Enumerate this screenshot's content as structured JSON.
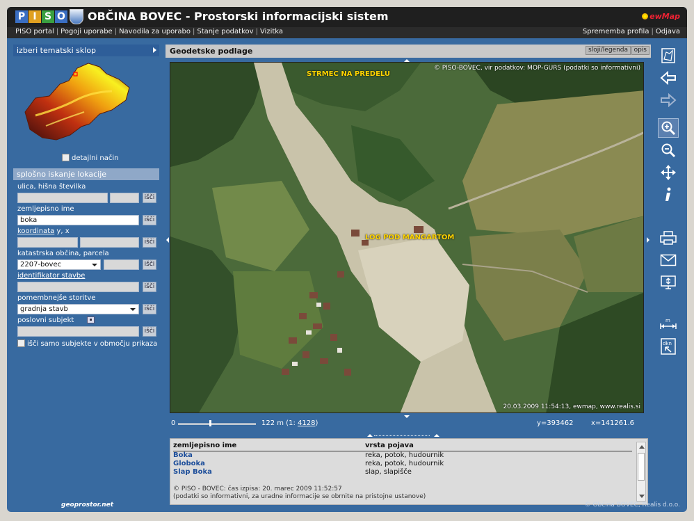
{
  "header": {
    "logo_letters": [
      "P",
      "I",
      "S",
      "O"
    ],
    "logo_colors": [
      "#3a6ec2",
      "#e0a020",
      "#3aa040",
      "#3a6ec2"
    ],
    "title": "OBČINA BOVEC - Prostorski informacijski sistem",
    "brand": "ewMap"
  },
  "menu": {
    "left": [
      "PISO portal",
      "Pogoji uporabe",
      "Navodila za uporabo",
      "Stanje podatkov",
      "Vizitka"
    ],
    "right": [
      "Sprememba profila",
      "Odjava"
    ]
  },
  "left_panel": {
    "thematic_header": "izberi tematski sklop",
    "detail_mode_label": "detajlni način",
    "search_header": "splošno iskanje lokacije",
    "search_button": "išči",
    "fields": {
      "street_label": "ulica, hišna številka",
      "geo_name_label": "zemljepisno ime",
      "geo_name_value": "boka",
      "coord_label_link": "koordinata",
      "coord_label_rest": " y, x",
      "cadastral_label": "katastrska občina, parcela",
      "cadastral_value": "2207-bovec",
      "building_id_label": "identifikator stavbe",
      "services_label": "pomembnejše storitve",
      "services_value": "gradnja stavb",
      "business_label": "poslovni subjekt",
      "area_only_label": "išči samo subjekte v območju prikaza"
    }
  },
  "map_panel": {
    "title": "Geodetske podlage",
    "btn_layers": "sloji/legenda",
    "btn_desc": "opis",
    "copyright": "© PISO-BOVEC, vir podatkov: MOP-GURS (podatki so informativni)",
    "timestamp": "20.03.2009 11:54:13, ewmap, www.realis.si",
    "labels": {
      "strmec": "STRMEC NA PREDELU",
      "log": "LOG POD MANGARTOM"
    },
    "scale_zero": "0",
    "scale_text": "122 m (1: ",
    "scale_link": "4128",
    "scale_close": ")",
    "coord_y": "y=393462",
    "coord_x": "x=141261.6"
  },
  "results": {
    "col_name": "zemljepisno ime",
    "col_type": "vrsta pojava",
    "rows": [
      {
        "name": "Boka",
        "type": "reka, potok, hudournik"
      },
      {
        "name": "Globoka",
        "type": "reka, potok, hudournik"
      },
      {
        "name": "Slap Boka",
        "type": "slap, slapišče"
      }
    ],
    "footer1": "© PISO - BOVEC: čas izpisa: 20. marec 2009 11:52:57",
    "footer2": "(podatki so informativni, za uradne informacije se obrnite na pristojne ustanove)"
  },
  "footer": {
    "left": "geoprostor.net",
    "right": "© Občina BOVEC, Realis d.o.o."
  }
}
